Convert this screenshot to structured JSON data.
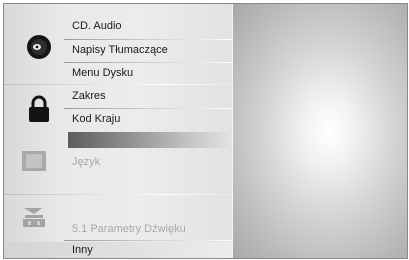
{
  "menu": {
    "disc_group": {
      "icon": "disc-icon",
      "items": [
        {
          "label": "CD. Audio"
        },
        {
          "label": "Napisy Tłumaczące"
        },
        {
          "label": "Menu Dysku"
        }
      ]
    },
    "lock_group": {
      "icon": "padlock-icon",
      "items": [
        {
          "label": "Zakres"
        },
        {
          "label": "Kod Kraju"
        }
      ]
    },
    "display_group": {
      "icon": "display-icon",
      "items": [
        {
          "label": "Język"
        }
      ]
    },
    "audio_group": {
      "icon": "speaker-icon",
      "items": [
        {
          "label": "5.1 Parametry Dźwięku"
        }
      ]
    },
    "other": {
      "label": "Inny"
    }
  },
  "colors": {
    "text": "#1a1a1a",
    "dim_text": "#a8a8a8",
    "highlight": "#5c5c5c"
  }
}
